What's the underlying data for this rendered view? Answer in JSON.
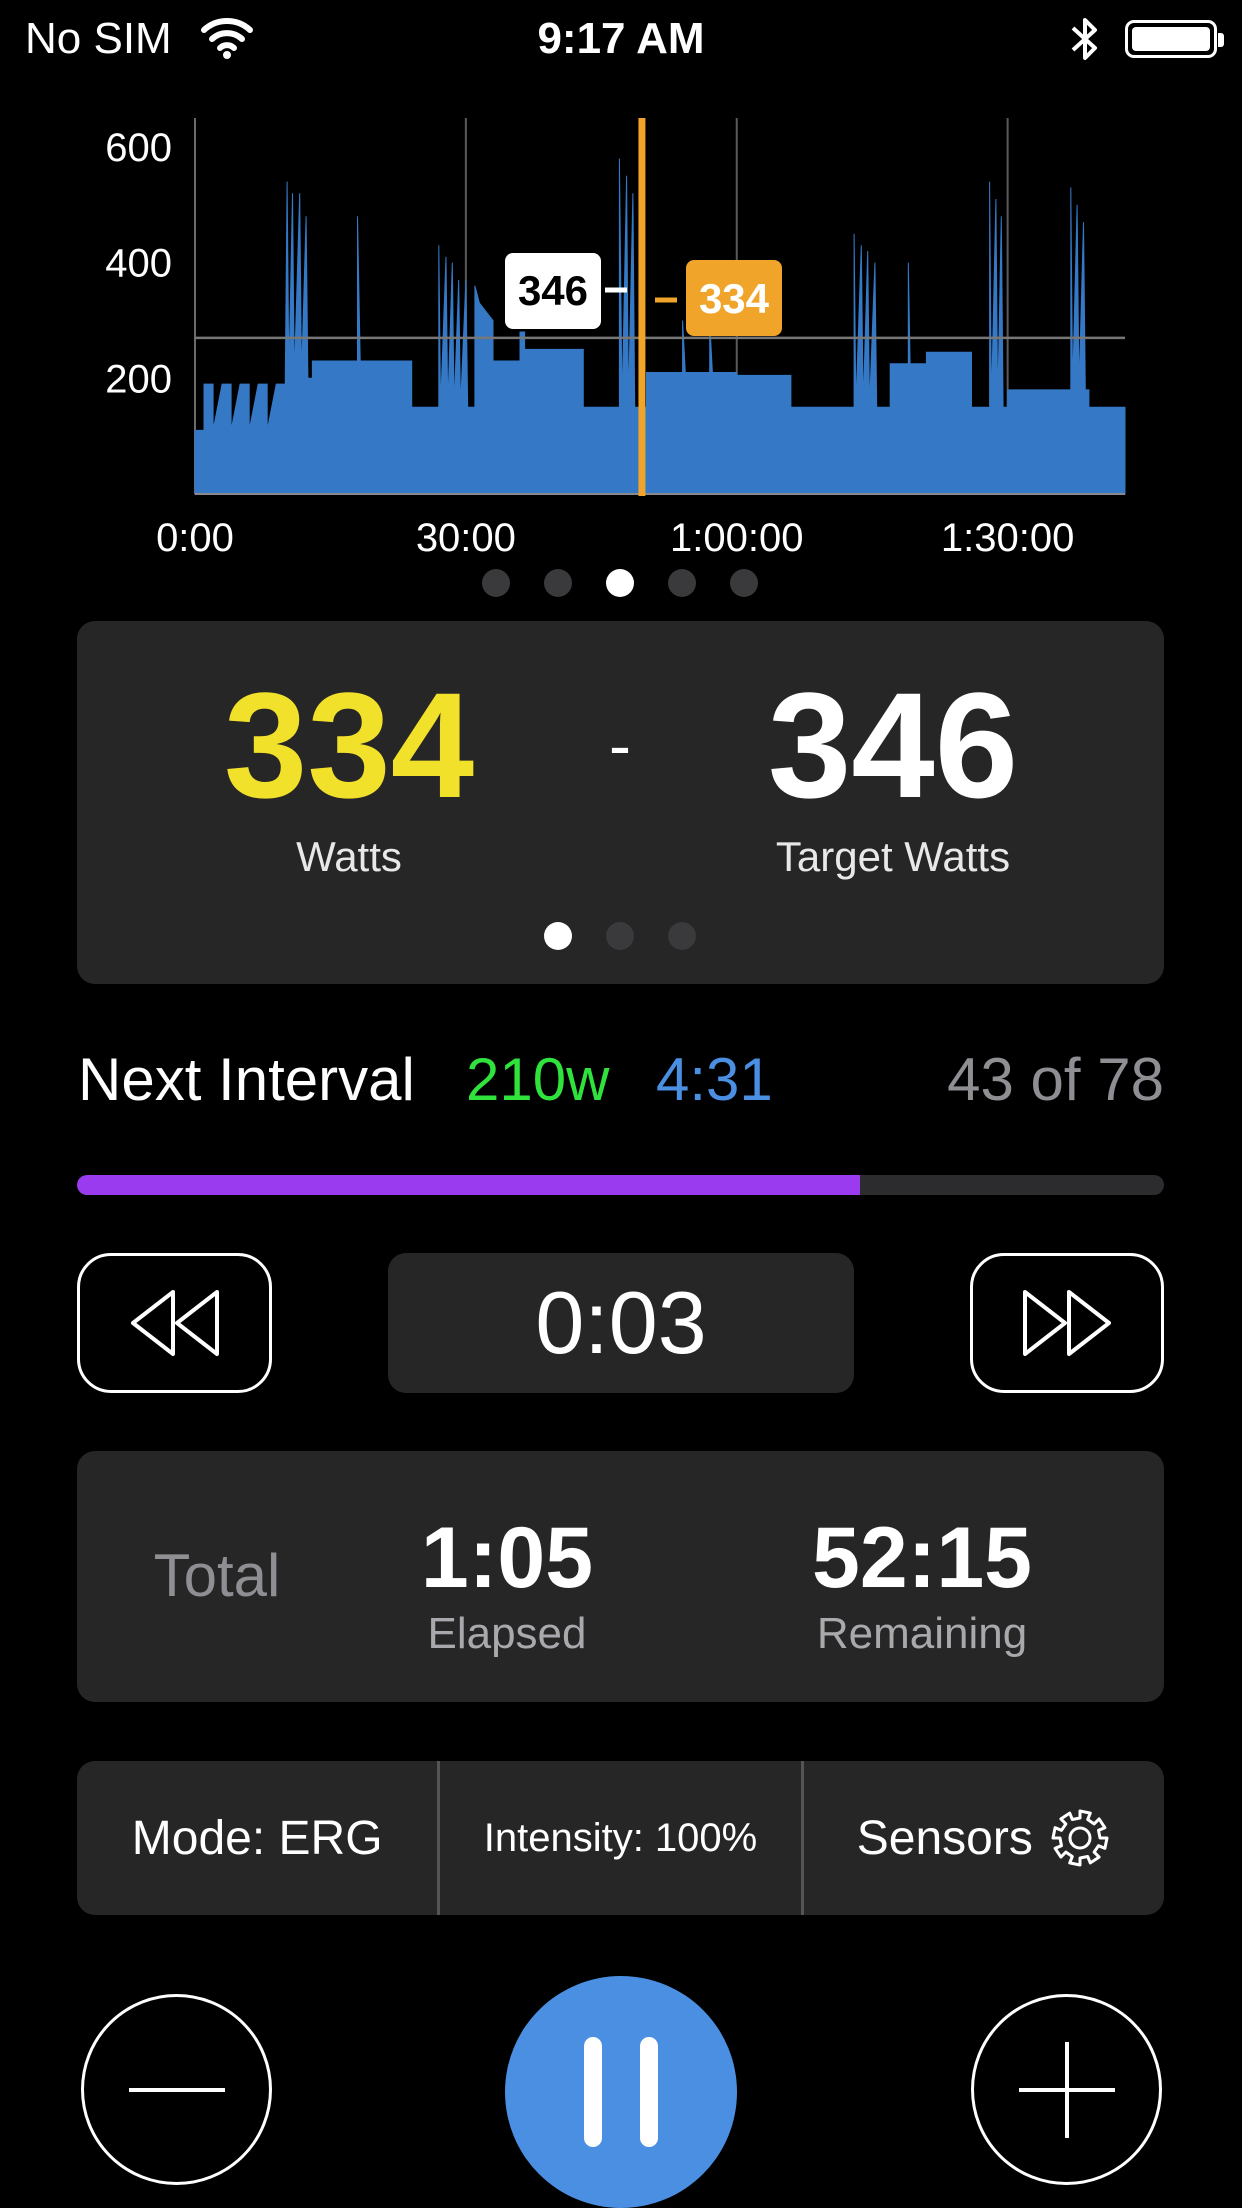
{
  "status_bar": {
    "carrier": "No SIM",
    "time": "9:17 AM"
  },
  "chart_data": {
    "type": "area",
    "x_label": "",
    "y_label": "",
    "x_ticks": [
      "0:00",
      "30:00",
      "1:00:00",
      "1:30:00"
    ],
    "x_tick_values_min": [
      0,
      30,
      60,
      90
    ],
    "y_ticks": [
      "200",
      "400",
      "600"
    ],
    "y_tick_values": [
      200,
      400,
      600
    ],
    "xlim_min": [
      0,
      103
    ],
    "ylim": [
      0,
      650
    ],
    "reference_line_w": 270,
    "current_position_min": 49.5,
    "marker_target": "346",
    "marker_current": "334",
    "series": [
      {
        "color": "#3579c6",
        "points": [
          [
            0,
            110
          ],
          [
            1,
            110
          ],
          [
            1,
            190
          ],
          [
            2,
            190
          ],
          [
            2,
            110
          ],
          [
            3,
            190
          ],
          [
            4,
            190
          ],
          [
            4,
            110
          ],
          [
            5,
            190
          ],
          [
            6,
            190
          ],
          [
            6,
            110
          ],
          [
            7,
            190
          ],
          [
            8,
            190
          ],
          [
            8,
            110
          ],
          [
            9,
            190
          ],
          [
            10,
            190
          ],
          [
            10,
            200
          ],
          [
            10.2,
            540
          ],
          [
            10.4,
            200
          ],
          [
            10.8,
            520
          ],
          [
            11,
            200
          ],
          [
            11.6,
            520
          ],
          [
            11.8,
            200
          ],
          [
            12.3,
            480
          ],
          [
            12.5,
            200
          ],
          [
            13,
            200
          ],
          [
            13,
            230
          ],
          [
            18,
            230
          ],
          [
            18,
            480
          ],
          [
            18.3,
            230
          ],
          [
            24,
            230
          ],
          [
            24,
            150
          ],
          [
            27,
            150
          ],
          [
            27,
            430
          ],
          [
            27.2,
            150
          ],
          [
            27.8,
            410
          ],
          [
            28,
            150
          ],
          [
            28.5,
            400
          ],
          [
            28.7,
            150
          ],
          [
            29.2,
            370
          ],
          [
            29.4,
            150
          ],
          [
            30,
            370
          ],
          [
            30.2,
            150
          ],
          [
            31,
            150
          ],
          [
            31,
            360
          ],
          [
            31.5,
            330
          ],
          [
            32,
            320
          ],
          [
            33,
            300
          ],
          [
            33,
            230
          ],
          [
            36,
            230
          ],
          [
            36,
            280
          ],
          [
            36.5,
            280
          ],
          [
            36.5,
            250
          ],
          [
            43,
            250
          ],
          [
            43,
            150
          ],
          [
            47,
            150
          ],
          [
            47,
            580
          ],
          [
            47.3,
            150
          ],
          [
            47.8,
            550
          ],
          [
            48,
            150
          ],
          [
            48.5,
            520
          ],
          [
            48.7,
            150
          ],
          [
            50,
            150
          ],
          [
            50,
            210
          ],
          [
            54,
            210
          ],
          [
            54,
            300
          ],
          [
            54.3,
            210
          ],
          [
            57,
            210
          ],
          [
            57,
            300
          ],
          [
            57.3,
            210
          ],
          [
            60,
            210
          ],
          [
            60,
            205
          ],
          [
            66,
            205
          ],
          [
            66,
            150
          ],
          [
            73,
            150
          ],
          [
            73,
            450
          ],
          [
            73.2,
            150
          ],
          [
            73.8,
            430
          ],
          [
            74,
            150
          ],
          [
            74.5,
            420
          ],
          [
            74.7,
            150
          ],
          [
            75.3,
            400
          ],
          [
            75.5,
            150
          ],
          [
            77,
            150
          ],
          [
            77,
            225
          ],
          [
            79,
            225
          ],
          [
            79,
            400
          ],
          [
            79.2,
            225
          ],
          [
            81,
            225
          ],
          [
            81,
            245
          ],
          [
            86,
            245
          ],
          [
            86,
            150
          ],
          [
            88,
            150
          ],
          [
            88,
            540
          ],
          [
            88.2,
            150
          ],
          [
            88.7,
            510
          ],
          [
            88.9,
            150
          ],
          [
            89.3,
            480
          ],
          [
            89.5,
            150
          ],
          [
            90,
            150
          ],
          [
            90,
            180
          ],
          [
            97,
            180
          ],
          [
            97,
            530
          ],
          [
            97.2,
            180
          ],
          [
            97.7,
            500
          ],
          [
            97.9,
            180
          ],
          [
            98.4,
            470
          ],
          [
            98.6,
            180
          ],
          [
            99,
            180
          ],
          [
            99,
            150
          ],
          [
            103,
            150
          ],
          [
            103,
            0
          ]
        ]
      }
    ]
  },
  "chart_pager": {
    "count": 5,
    "active": 2
  },
  "power": {
    "current_value": "334",
    "current_label": "Watts",
    "separator": "-",
    "target_value": "346",
    "target_label": "Target Watts",
    "pager_count": 3,
    "pager_active": 0
  },
  "next_interval": {
    "label": "Next Interval",
    "watts": "210w",
    "duration": "4:31",
    "position": "43 of 78"
  },
  "interval_progress": 0.72,
  "interval_timer": "0:03",
  "totals": {
    "label": "Total",
    "elapsed_value": "1:05",
    "elapsed_label": "Elapsed",
    "remaining_value": "52:15",
    "remaining_label": "Remaining"
  },
  "mode_bar": {
    "mode": "Mode: ERG",
    "intensity": "Intensity: 100%",
    "sensors": "Sensors"
  },
  "colors": {
    "current_watts": "#f2e12a",
    "next_watts": "#2fe23c",
    "next_duration": "#4a8fe2",
    "progress": "#9b3bf0",
    "chart_bar": "#3579c6",
    "position_marker": "#f0a52a",
    "pause_button": "#4a8fe2"
  },
  "icons": {
    "wifi": "wifi-icon",
    "bluetooth": "bluetooth-icon",
    "battery": "battery-icon",
    "rewind": "rewind-icon",
    "fast_forward": "fast-forward-icon",
    "gear": "gear-icon",
    "minus": "minus-icon",
    "plus": "plus-icon",
    "pause": "pause-icon"
  }
}
